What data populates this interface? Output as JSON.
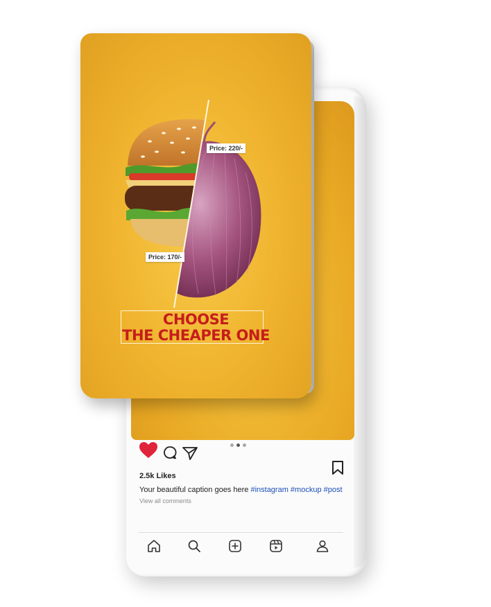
{
  "post": {
    "price_left": "Price: 170/-",
    "price_right": "Price: 220/-",
    "headline_line1": "CHOOSE",
    "headline_line2": "THE CHEAPER ONE"
  },
  "feed": {
    "likes": "2.5k Likes",
    "caption_text": "Your beautiful caption goes here",
    "caption_tags": "#instagram #mockup #post",
    "view_comments": "View all comments",
    "carousel_total": 3,
    "carousel_active": 2
  },
  "icons": {
    "like": "heart-icon",
    "comment": "comment-icon",
    "share": "send-icon",
    "save": "bookmark-icon",
    "nav": [
      "home-icon",
      "search-icon",
      "add-post-icon",
      "reels-icon",
      "profile-icon"
    ]
  },
  "colors": {
    "like_red": "#e0243b",
    "headline_red": "#c61d1c",
    "hashtag_blue": "#1d4fb8",
    "post_yellow": "#efb22d"
  }
}
